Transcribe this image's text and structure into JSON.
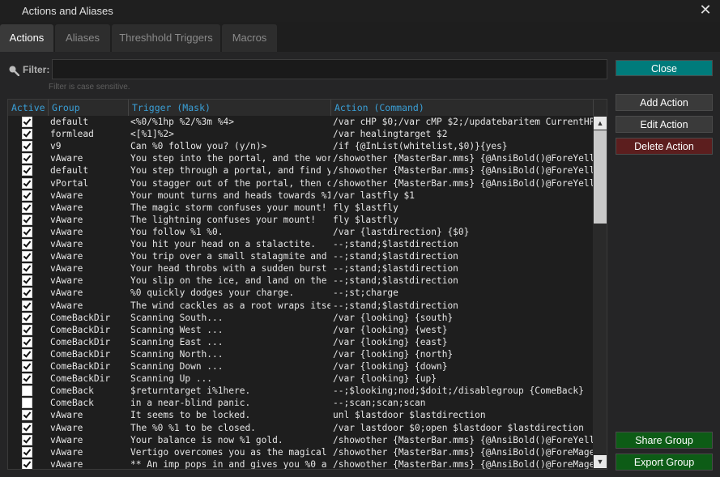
{
  "window": {
    "title": "Actions and Aliases",
    "close_glyph": "✕"
  },
  "tabs": [
    {
      "label": "Actions",
      "active": true
    },
    {
      "label": "Aliases",
      "active": false
    },
    {
      "label": "Threshhold Triggers",
      "active": false
    },
    {
      "label": "Macros",
      "active": false
    }
  ],
  "filter": {
    "label": "Filter:",
    "value": "",
    "placeholder": "",
    "hint": "Filter is case sensitive.",
    "icon": "search-icon"
  },
  "buttons": {
    "close": "Close",
    "add_action": "Add Action",
    "edit_action": "Edit Action",
    "delete_action": "Delete Action",
    "share_group": "Share Group",
    "export_group": "Export Group"
  },
  "colors": {
    "close_bg": "#007b7b",
    "neutral_bg": "#3a3a3a",
    "delete_bg": "#5c1e1e",
    "share_bg": "#0d5c16",
    "header_text": "#3aa0d8"
  },
  "grid": {
    "columns": [
      "Active",
      "Group",
      "Trigger (Mask)",
      "Action (Command)"
    ],
    "rows": [
      {
        "active": true,
        "group": "default",
        "trigger": "<%0/%1hp %2/%3m %4>",
        "action": "/var cHP $0;/var cMP $2;/updatebaritem CurrentHP"
      },
      {
        "active": true,
        "group": "formlead",
        "trigger": "<[%1]%2>",
        "action": "/var healingtarget $2"
      },
      {
        "active": true,
        "group": "v9",
        "trigger": "Can %0 follow you? (y/n)>",
        "action": "/if {@InList(whitelist,$0)}{yes}"
      },
      {
        "active": true,
        "group": "vAware",
        "trigger": "You step into the portal, and the wor",
        "action": "/showother {MasterBar.mms} {@AnsiBold()@ForeYello"
      },
      {
        "active": true,
        "group": "default",
        "trigger": "You step through a portal, and find y",
        "action": "/showother {MasterBar.mms} {@AnsiBold()@ForeYello"
      },
      {
        "active": true,
        "group": "vPortal",
        "trigger": "You stagger out of the portal, then c",
        "action": "/showother {MasterBar.mms} {@AnsiBold()@ForeYello"
      },
      {
        "active": true,
        "group": "vAware",
        "trigger": "Your mount turns and heads towards %1",
        "action": "/var lastfly $1"
      },
      {
        "active": true,
        "group": "vAware",
        "trigger": "The magic storm confuses your mount!",
        "action": "fly $lastfly"
      },
      {
        "active": true,
        "group": "vAware",
        "trigger": "The lightning confuses your mount!",
        "action": "fly $lastfly"
      },
      {
        "active": true,
        "group": "vAware",
        "trigger": "You follow %1 %0.",
        "action": "/var {lastdirection} {$0}"
      },
      {
        "active": true,
        "group": "vAware",
        "trigger": "You hit your head on a stalactite.",
        "action": "--;stand;$lastdirection"
      },
      {
        "active": true,
        "group": "vAware",
        "trigger": "You trip over a small stalagmite and",
        "action": "--;stand;$lastdirection"
      },
      {
        "active": true,
        "group": "vAware",
        "trigger": "Your head throbs with a sudden burst",
        "action": "--;stand;$lastdirection"
      },
      {
        "active": true,
        "group": "vAware",
        "trigger": "You slip on the ice, and land on the",
        "action": "--;stand;$lastdirection"
      },
      {
        "active": true,
        "group": "vAware",
        "trigger": "%0 quickly dodges your charge.",
        "action": "--;st;charge"
      },
      {
        "active": true,
        "group": "vAware",
        "trigger": "The wind cackles as a root wraps itse",
        "action": "--;stand;$lastdirection"
      },
      {
        "active": true,
        "group": "ComeBackDir",
        "trigger": "Scanning South...",
        "action": "/var {looking} {south}"
      },
      {
        "active": true,
        "group": "ComeBackDir",
        "trigger": "Scanning West ...",
        "action": "/var {looking} {west}"
      },
      {
        "active": true,
        "group": "ComeBackDir",
        "trigger": "Scanning East ...",
        "action": "/var {looking} {east}"
      },
      {
        "active": true,
        "group": "ComeBackDir",
        "trigger": "Scanning North...",
        "action": "/var {looking} {north}"
      },
      {
        "active": true,
        "group": "ComeBackDir",
        "trigger": "Scanning Down ...",
        "action": "/var {looking} {down}"
      },
      {
        "active": true,
        "group": "ComeBackDir",
        "trigger": "Scanning Up   ...",
        "action": "/var {looking} {up}"
      },
      {
        "active": false,
        "group": "ComeBack",
        "trigger": "$returntarget i%1here.",
        "action": "--;$looking;nod;$doit;/disablegroup {ComeBack}"
      },
      {
        "active": false,
        "group": "ComeBack",
        "trigger": "in a near-blind panic.",
        "action": "--;scan;scan;scan"
      },
      {
        "active": true,
        "group": "vAware",
        "trigger": "It seems to be locked.",
        "action": "unl $lastdoor $lastdirection"
      },
      {
        "active": true,
        "group": "vAware",
        "trigger": "The %0 %1 to be closed.",
        "action": "/var lastdoor $0;open $lastdoor $lastdirection"
      },
      {
        "active": true,
        "group": "vAware",
        "trigger": "Your balance is now %1 gold.",
        "action": "/showother {MasterBar.mms} {@AnsiBold()@ForeYello"
      },
      {
        "active": true,
        "group": "vAware",
        "trigger": "Vertigo overcomes you as the magical",
        "action": "/showother {MasterBar.mms} {@AnsiBold()@ForeMage"
      },
      {
        "active": true,
        "group": "vAware",
        "trigger": " ** An imp pops in and gives you %0 a",
        "action": "/showother {MasterBar.mms} {@AnsiBold()@ForeMage"
      }
    ]
  },
  "scrollbar": {
    "up_glyph": "▲",
    "down_glyph": "▼"
  }
}
